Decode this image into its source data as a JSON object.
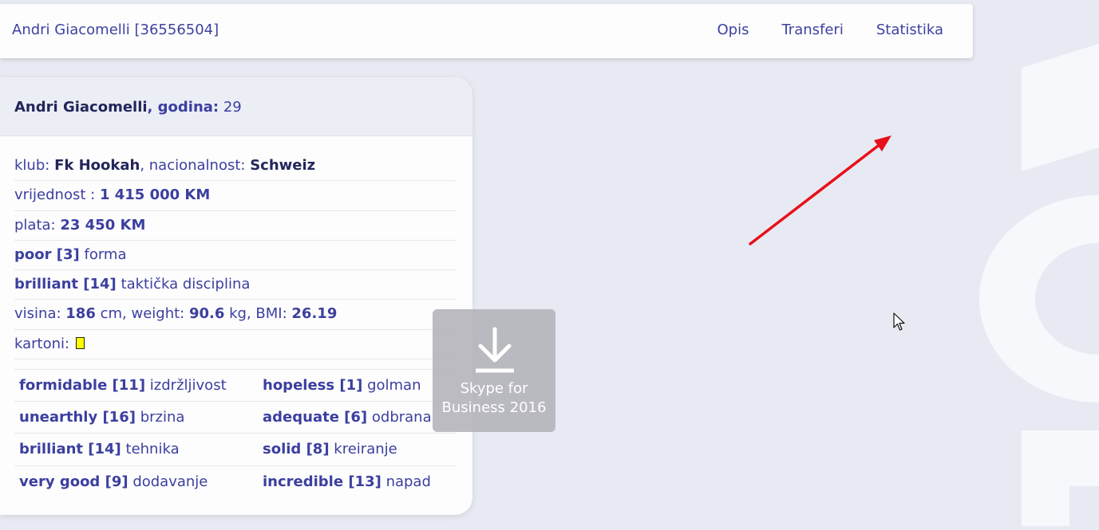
{
  "navbar": {
    "brand": "Andri Giacomelli [36556504]",
    "links": [
      "Opis",
      "Transferi",
      "Statistika"
    ]
  },
  "player": {
    "name": "Andri Giacomelli",
    "age_label": ", godina:",
    "age": "29",
    "club_label": "klub:",
    "club": "Fk Hookah",
    "nationality_label": ", nacionalnost:",
    "nationality": "Schweiz",
    "value_label": "vrijednost :",
    "value": "1 415 000 KM",
    "salary_label": "plata:",
    "salary": "23 450 KM",
    "form_value": "poor [3]",
    "form_label": "forma",
    "discipline_value": "brilliant [14]",
    "discipline_label": "taktička disciplina",
    "height_label": "visina:",
    "height": "186",
    "height_unit": "cm, weight:",
    "weight": "90.6",
    "weight_unit": "kg, BMI:",
    "bmi": "26.19",
    "cards_label": "kartoni:"
  },
  "attributes": [
    [
      {
        "value": "formidable [11]",
        "label": "izdržljivost"
      },
      {
        "value": "hopeless [1]",
        "label": "golman"
      }
    ],
    [
      {
        "value": "unearthly [16]",
        "label": "brzina"
      },
      {
        "value": "adequate [6]",
        "label": "odbrana"
      }
    ],
    [
      {
        "value": "brilliant [14]",
        "label": "tehnika"
      },
      {
        "value": "solid [8]",
        "label": "kreiranje"
      }
    ],
    [
      {
        "value": "very good [9]",
        "label": "dodavanje"
      },
      {
        "value": "incredible [13]",
        "label": "napad"
      }
    ]
  ],
  "popup": {
    "line1": "Skype for",
    "line2": "Business 2016"
  },
  "colors": {
    "accent": "#3b3f9e",
    "dark": "#23265a",
    "background": "#e8eaf3",
    "annotation_arrow": "#e8101a",
    "yellow_card": "#ffff00"
  }
}
